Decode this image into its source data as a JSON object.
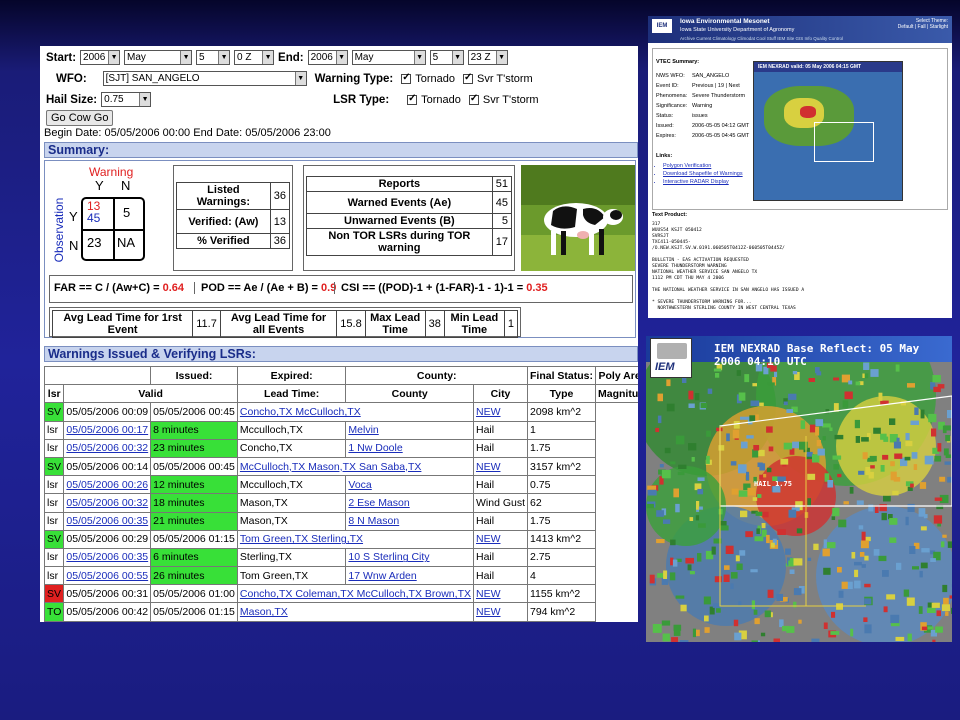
{
  "form": {
    "start_label": "Start:",
    "end_label": "End:",
    "start": {
      "year": "2006",
      "month": "May",
      "day": "5",
      "hour": "0 Z"
    },
    "end": {
      "year": "2006",
      "month": "May",
      "day": "5",
      "hour": "23 Z"
    },
    "wfo_label": "WFO:",
    "wfo_value": "[SJT] SAN_ANGELO",
    "warning_type_label": "Warning Type:",
    "lsr_type_label": "LSR Type:",
    "tornado": "Tornado",
    "svr": "Svr T'storm",
    "hail_label": "Hail Size:",
    "hail_value": "0.75",
    "go_button": "Go Cow Go",
    "dates": "Begin Date: 05/05/2006 00:00 End Date: 05/05/2006 23:00"
  },
  "summary": {
    "title": "Summary:",
    "matrix": {
      "warning": "Warning",
      "y": "Y",
      "n": "N",
      "observation": "Observation",
      "yy_red": "13",
      "yy_blue": "45",
      "yn": "5",
      "ny": "23",
      "nn": "NA"
    },
    "listed_label": "Listed Warnings:",
    "listed": "36",
    "verified_label": "Verified: (Aw)",
    "verified": "13",
    "pct_label": "% Verified",
    "pct": "36",
    "reports_label": "Reports",
    "reports": "51",
    "warned_label": "Warned Events (Ae)",
    "warned": "45",
    "unwarned_label": "Unwarned Events (B)",
    "unwarned": "5",
    "nontor_label": "Non TOR LSRs during TOR warning",
    "nontor": "17",
    "far_label": "FAR == C / (Aw+C) =",
    "far": "0.64",
    "pod_label": "POD == Ae / (Ae + B) =",
    "pod": "0.9",
    "csi_label": "CSI == ((POD)-1 + (1-FAR)-1 - 1)-1 =",
    "csi": "0.35",
    "avg_lead_first_label": "Avg Lead Time for 1rst Event",
    "avg_lead_first": "11.7",
    "avg_lead_all_label": "Avg Lead Time for all Events",
    "avg_lead_all": "15.8",
    "max_lead_label": "Max Lead Time",
    "max_lead": "38",
    "min_lead_label": "Min Lead Time",
    "min_lead": "1"
  },
  "warnings": {
    "title": "Warnings Issued & Verifying LSRs:",
    "header1": [
      "",
      "Issued:",
      "Expired:",
      "County:",
      "Final Status:",
      "Poly Area:"
    ],
    "header2": [
      "lsr",
      "Valid",
      "Lead Time:",
      "County",
      "City",
      "Type",
      "Magnitude"
    ],
    "rows": [
      {
        "k": "w",
        "tag": "SV",
        "c": "g",
        "issued": "05/05/2006 00:09",
        "expired": "05/05/2006 00:45",
        "county": "Concho,TX McCulloch,TX",
        "status": "NEW",
        "area": "2098 km^2"
      },
      {
        "k": "l",
        "tag": "lsr",
        "valid": "05/05/2006 00:17",
        "lead": "8 minutes",
        "county": "Mcculloch,TX",
        "city": "Melvin",
        "type": "Hail",
        "mag": "1"
      },
      {
        "k": "l",
        "tag": "lsr",
        "valid": "05/05/2006 00:32",
        "lead": "23 minutes",
        "county": "Concho,TX",
        "city": "1 Nw Doole",
        "type": "Hail",
        "mag": "1.75"
      },
      {
        "k": "w",
        "tag": "SV",
        "c": "g",
        "issued": "05/05/2006 00:14",
        "expired": "05/05/2006 00:45",
        "county": "McCulloch,TX Mason,TX San Saba,TX",
        "status": "NEW",
        "area": "3157 km^2"
      },
      {
        "k": "l",
        "tag": "lsr",
        "valid": "05/05/2006 00:26",
        "lead": "12 minutes",
        "county": "Mcculloch,TX",
        "city": "Voca",
        "type": "Hail",
        "mag": "0.75"
      },
      {
        "k": "l",
        "tag": "lsr",
        "valid": "05/05/2006 00:32",
        "lead": "18 minutes",
        "county": "Mason,TX",
        "city": "2 Ese Mason",
        "type": "Wind Gust",
        "mag": "62"
      },
      {
        "k": "l",
        "tag": "lsr",
        "valid": "05/05/2006 00:35",
        "lead": "21 minutes",
        "county": "Mason,TX",
        "city": "8 N Mason",
        "type": "Hail",
        "mag": "1.75"
      },
      {
        "k": "w",
        "tag": "SV",
        "c": "g",
        "issued": "05/05/2006 00:29",
        "expired": "05/05/2006 01:15",
        "county": "Tom Green,TX Sterling,TX",
        "status": "NEW",
        "area": "1413 km^2"
      },
      {
        "k": "l",
        "tag": "lsr",
        "valid": "05/05/2006 00:35",
        "lead": "6 minutes",
        "county": "Sterling,TX",
        "city": "10 S Sterling City",
        "type": "Hail",
        "mag": "2.75"
      },
      {
        "k": "l",
        "tag": "lsr",
        "valid": "05/05/2006 00:55",
        "lead": "26 minutes",
        "county": "Tom Green,TX",
        "city": "17 Wnw Arden",
        "type": "Hail",
        "mag": "4"
      },
      {
        "k": "w",
        "tag": "SV",
        "c": "rd",
        "issued": "05/05/2006 00:31",
        "expired": "05/05/2006 01:00",
        "county": "Concho,TX Coleman,TX McCulloch,TX Brown,TX",
        "status": "NEW",
        "area": "1155 km^2"
      },
      {
        "k": "w",
        "tag": "TO",
        "c": "g",
        "issued": "05/05/2006 00:42",
        "expired": "05/05/2006 01:15",
        "county": "Mason,TX",
        "status": "NEW",
        "area": "794 km^2"
      }
    ]
  },
  "vtec": {
    "title1": "Iowa Environmental Mesonet",
    "title2": "Iowa State University Department of Agronomy",
    "theme_label": "Select Theme:",
    "themes": "Default | Fall | Starlight",
    "nav": "Archive  Current  Climatology  Climodat  Cool Stuff  IEM Site  GIS  Info  Quality Control",
    "summary_title": "VTEC Summary:",
    "fields": [
      [
        "NWS WFO:",
        "SAN_ANGELO"
      ],
      [
        "Event ID:",
        "Previous | 19 | Next"
      ],
      [
        "Phenomena:",
        "Severe Thunderstorm"
      ],
      [
        "Significance:",
        "Warning"
      ],
      [
        "Status:",
        "issues"
      ],
      [
        "Issued:",
        "2006-05-05 04:12 GMT"
      ],
      [
        "Expires:",
        "2006-05-05 04:45 GMT"
      ]
    ],
    "mini_radar_title": "IEM NEXRAD valid: 05 May 2006 04:15 GMT",
    "links_title": "Links:",
    "links": [
      "Polygon Verification",
      "Download Shapefile of Warnings",
      "Interactive RADAR Display"
    ],
    "product_title": "Text Product:",
    "product": [
      "317",
      "WUUS54 KSJT 050412",
      "SVRSJT",
      "TXC411-050445-",
      "/O.NEW.KSJT.SV.W.0191.060505T0412Z-060505T0445Z/",
      "",
      "BULLETIN - EAS ACTIVATION REQUESTED",
      "SEVERE THUNDERSTORM WARNING",
      "NATIONAL WEATHER SERVICE SAN ANGELO TX",
      "1112 PM CDT THU MAY 4 2006",
      "",
      "THE NATIONAL WEATHER SERVICE IN SAN ANGELO HAS ISSUED A",
      "",
      "* SEVERE THUNDERSTORM WARNING FOR...",
      "  NORTHWESTERN STERLING COUNTY IN WEST CENTRAL TEXAS"
    ]
  },
  "radar": {
    "title": "IEM NEXRAD Base Reflect: 05 May 2006 04:10 UTC",
    "logo": "IEM",
    "hail_label": "HAIL 1.75"
  }
}
